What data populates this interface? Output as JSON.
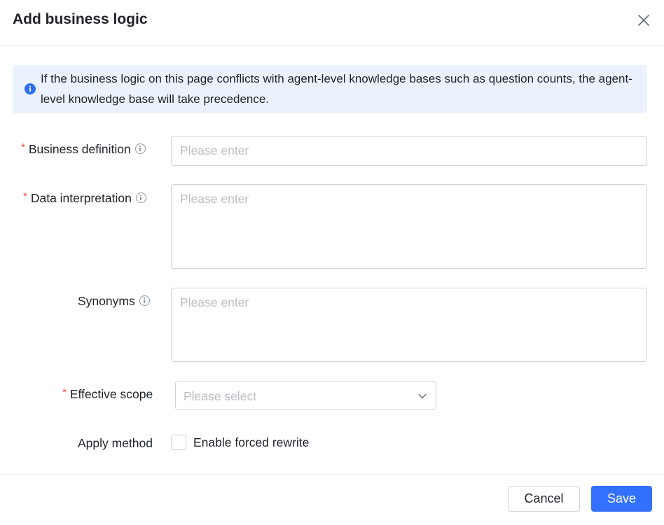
{
  "dialog": {
    "title": "Add business logic",
    "close_icon": "close-icon"
  },
  "alert": {
    "icon": "info-icon",
    "text": "If the business logic on this page conflicts with agent-level knowledge bases such as question counts, the agent-level knowledge base will take precedence."
  },
  "form": {
    "business_definition": {
      "required_mark": "*",
      "label": "Business definition",
      "placeholder": "Please enter",
      "value": ""
    },
    "data_interpretation": {
      "required_mark": "*",
      "label": "Data interpretation",
      "placeholder": "Please enter",
      "value": ""
    },
    "synonyms": {
      "label": "Synonyms",
      "placeholder": "Please enter",
      "value": ""
    },
    "effective_scope": {
      "required_mark": "*",
      "label": "Effective scope",
      "placeholder": "Please select"
    },
    "apply_method": {
      "label": "Apply method",
      "checkbox_label": "Enable forced rewrite",
      "checked": false
    }
  },
  "footer": {
    "cancel_label": "Cancel",
    "save_label": "Save"
  },
  "colors": {
    "primary": "#3370ff",
    "required": "#f54a45",
    "alert_background": "#ebf2fe",
    "info_icon": "#2c6fef"
  }
}
